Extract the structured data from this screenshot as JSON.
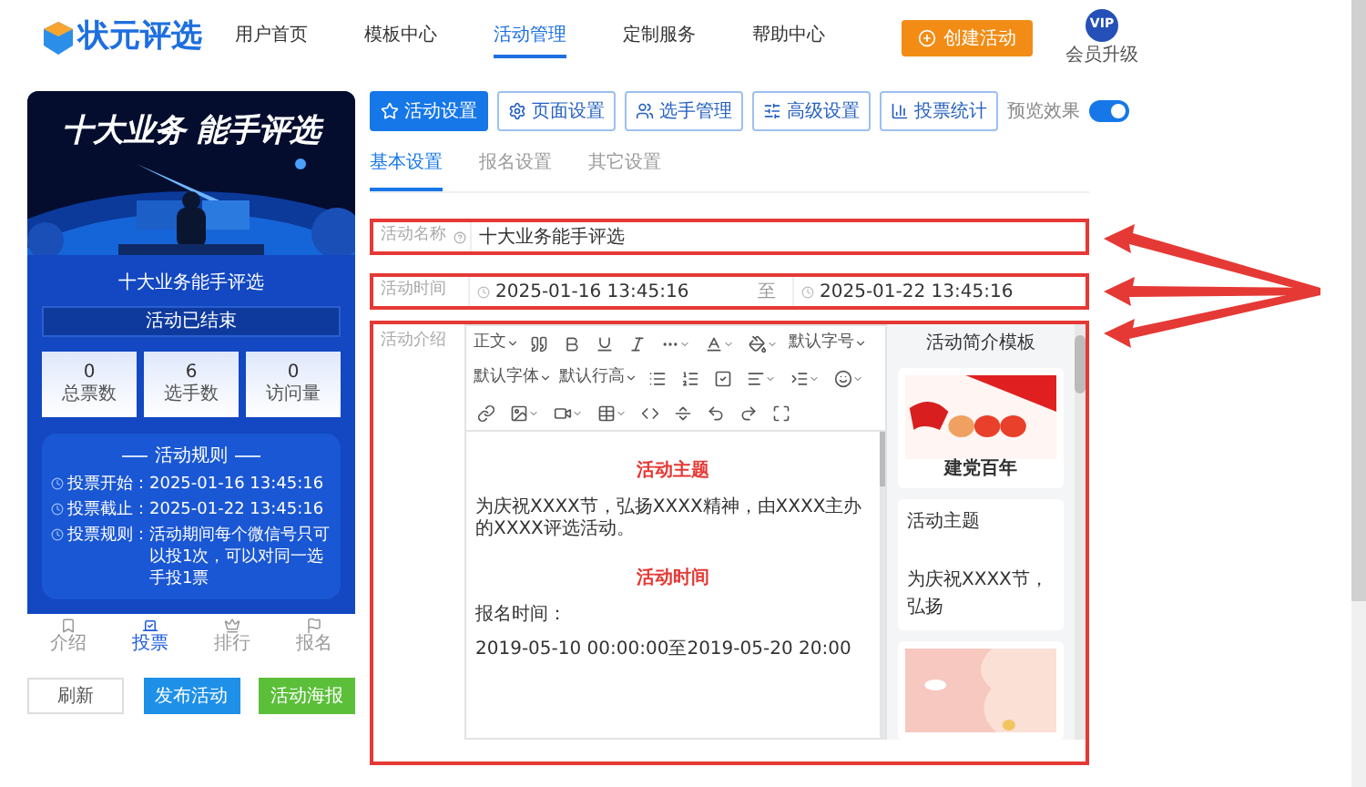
{
  "brand": {
    "name": "状元评选"
  },
  "nav": [
    {
      "label": "用户首页",
      "selected": false
    },
    {
      "label": "模板中心",
      "selected": false
    },
    {
      "label": "活动管理",
      "selected": true
    },
    {
      "label": "定制服务",
      "selected": false
    },
    {
      "label": "帮助中心",
      "selected": false
    }
  ],
  "create_button": "创建活动",
  "vip": {
    "badge": "VIP",
    "label": "会员升级"
  },
  "preview": {
    "banner_title": "十大业务 能手评选",
    "title": "十大业务能手评选",
    "status": "活动已结束",
    "stats": [
      {
        "value": "0",
        "label": "总票数"
      },
      {
        "value": "6",
        "label": "选手数"
      },
      {
        "value": "0",
        "label": "访问量"
      }
    ],
    "rules_title": "活动规则",
    "rules": [
      {
        "label": "投票开始：",
        "text": "2025-01-16 13:45:16"
      },
      {
        "label": "投票截止：",
        "text": "2025-01-22 13:45:16"
      },
      {
        "label": "投票规则：",
        "text": "活动期间每个微信号只可以投1次，可以对同一选手投1票"
      }
    ],
    "tabbar": [
      {
        "label": "介绍",
        "selected": false
      },
      {
        "label": "投票",
        "selected": true
      },
      {
        "label": "排行",
        "selected": false
      },
      {
        "label": "报名",
        "selected": false
      }
    ]
  },
  "actions": [
    {
      "label": "刷新",
      "kind": "plain"
    },
    {
      "label": "发布活动",
      "kind": "primary"
    },
    {
      "label": "活动海报",
      "kind": "success"
    }
  ],
  "settings_tabs": [
    {
      "label": "活动设置",
      "selected": true
    },
    {
      "label": "页面设置",
      "selected": false
    },
    {
      "label": "选手管理",
      "selected": false
    },
    {
      "label": "高级设置",
      "selected": false
    },
    {
      "label": "投票统计",
      "selected": false
    }
  ],
  "preview_toggle": {
    "label": "预览效果",
    "on": true
  },
  "subtabs": [
    {
      "label": "基本设置",
      "selected": true
    },
    {
      "label": "报名设置",
      "selected": false
    },
    {
      "label": "其它设置",
      "selected": false
    }
  ],
  "form": {
    "name": {
      "label": "活动名称",
      "value": "十大业务能手评选"
    },
    "time": {
      "label": "活动时间",
      "start": "2025-01-16 13:45:16",
      "separator": "至",
      "end": "2025-01-22 13:45:16"
    },
    "intro": {
      "label": "活动介绍",
      "dropdowns": [
        "正文",
        "默认字号",
        "默认字体",
        "默认行高"
      ],
      "content": [
        {
          "kind": "heading",
          "text": "活动主题"
        },
        {
          "kind": "paragraph",
          "text": "为庆祝XXXX节，弘扬XXXX精神，由XXXX主办的XXXX评选活动。"
        },
        {
          "kind": "heading",
          "text": "活动时间"
        },
        {
          "kind": "paragraph",
          "text": "报名时间："
        },
        {
          "kind": "paragraph",
          "text": "2019-05-10 00:00:00至2019-05-20 20:00"
        }
      ],
      "templates": {
        "title": "活动简介模板",
        "items": [
          {
            "kind": "picture",
            "caption": "建党百年"
          },
          {
            "kind": "text",
            "title": "活动主题",
            "text": "为庆祝XXXX节，弘扬"
          },
          {
            "kind": "picture"
          }
        ]
      }
    }
  }
}
